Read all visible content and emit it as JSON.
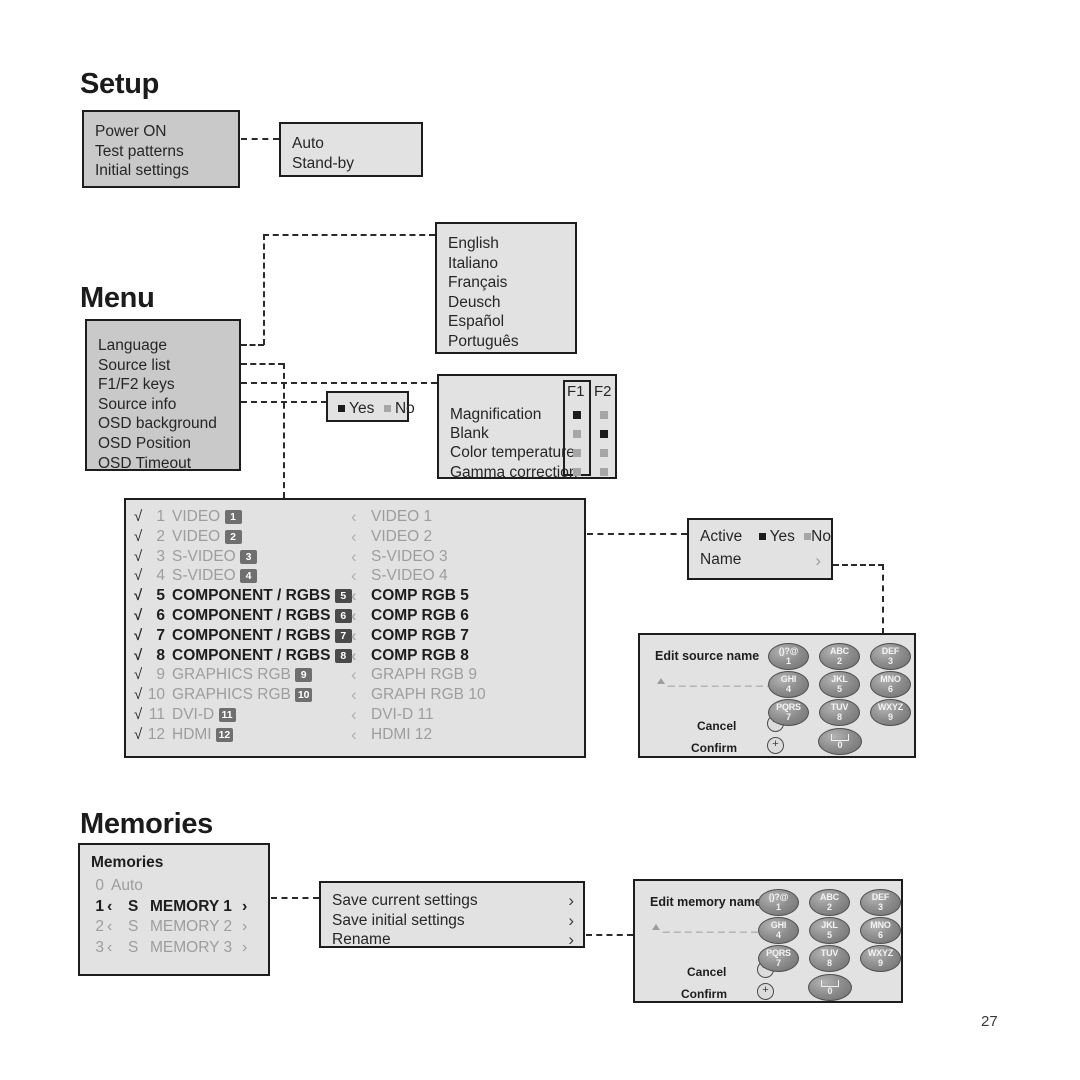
{
  "page": {
    "number": "27"
  },
  "sections": {
    "setup": {
      "title": "Setup"
    },
    "menu": {
      "title": "Menu"
    },
    "memories": {
      "title": "Memories"
    }
  },
  "setup": {
    "main_menu": {
      "items": [
        "Power ON",
        "Test patterns",
        "Initial settings"
      ]
    },
    "power_on_submenu": {
      "items": [
        "Auto",
        "Stand-by"
      ]
    }
  },
  "menu": {
    "main_menu": {
      "items": [
        "Language",
        "Source list",
        "F1/F2 keys",
        "Source info",
        "OSD background",
        "OSD Position",
        "OSD Timeout"
      ]
    },
    "language_submenu": {
      "items": [
        "English",
        "Italiano",
        "Français",
        "Deusch",
        "Español",
        "Português"
      ]
    },
    "source_info_submenu": {
      "options": [
        {
          "label": "Yes",
          "selected": true
        },
        {
          "label": "No",
          "selected": false
        }
      ]
    },
    "f1f2_submenu": {
      "columns": [
        "F1",
        "F2"
      ],
      "rows": [
        {
          "label": "Magnification",
          "f1": true,
          "f2": false
        },
        {
          "label": "Blank",
          "f1": false,
          "f2": true
        },
        {
          "label": "Color temperature",
          "f1": false,
          "f2": false
        },
        {
          "label": "Gamma correction",
          "f1": false,
          "f2": false
        }
      ]
    }
  },
  "source_list": {
    "rows": [
      {
        "check": "√",
        "index": "1",
        "name": "VIDEO",
        "badge": "1",
        "right": "VIDEO 1",
        "active": false
      },
      {
        "check": "√",
        "index": "2",
        "name": "VIDEO",
        "badge": "2",
        "right": "VIDEO 2",
        "active": false
      },
      {
        "check": "√",
        "index": "3",
        "name": "S-VIDEO",
        "badge": "3",
        "right": "S-VIDEO 3",
        "active": false
      },
      {
        "check": "√",
        "index": "4",
        "name": "S-VIDEO",
        "badge": "4",
        "right": "S-VIDEO 4",
        "active": false
      },
      {
        "check": "√",
        "index": "5",
        "name": "COMPONENT / RGBS",
        "badge": "5",
        "right": "COMP RGB 5",
        "active": true
      },
      {
        "check": "√",
        "index": "6",
        "name": "COMPONENT / RGBS",
        "badge": "6",
        "right": "COMP RGB 6",
        "active": true
      },
      {
        "check": "√",
        "index": "7",
        "name": "COMPONENT / RGBS",
        "badge": "7",
        "right": "COMP RGB 7",
        "active": true
      },
      {
        "check": "√",
        "index": "8",
        "name": "COMPONENT / RGBS",
        "badge": "8",
        "right": "COMP RGB 8",
        "active": true
      },
      {
        "check": "√",
        "index": "9",
        "name": "GRAPHICS RGB",
        "badge": "9",
        "right": "GRAPH RGB 9",
        "active": false
      },
      {
        "check": "√",
        "index": "10",
        "name": "GRAPHICS RGB",
        "badge": "10",
        "right": "GRAPH RGB 10",
        "active": false
      },
      {
        "check": "√",
        "index": "11",
        "name": "DVI-D",
        "badge": "11",
        "right": "DVI-D 11",
        "active": false
      },
      {
        "check": "√",
        "index": "12",
        "name": "HDMI",
        "badge": "12",
        "right": "HDMI 12",
        "active": false
      }
    ]
  },
  "source_properties": {
    "active_label": "Active",
    "options": [
      {
        "label": "Yes",
        "selected": true
      },
      {
        "label": "No",
        "selected": false
      }
    ],
    "name_label": "Name",
    "name_chevron": "›"
  },
  "edit_source_name": {
    "title": "Edit source name",
    "field_value": "_ _ _ _ _ _ _ _ _ _",
    "cancel_label": "Cancel",
    "cancel_symbol": "−",
    "confirm_label": "Confirm",
    "confirm_symbol": "+",
    "keys": [
      {
        "letters": "()?@",
        "digit": "1"
      },
      {
        "letters": "ABC",
        "digit": "2"
      },
      {
        "letters": "DEF",
        "digit": "3"
      },
      {
        "letters": "GHI",
        "digit": "4"
      },
      {
        "letters": "JKL",
        "digit": "5"
      },
      {
        "letters": "MNO",
        "digit": "6"
      },
      {
        "letters": "PQRS",
        "digit": "7"
      },
      {
        "letters": "TUV",
        "digit": "8"
      },
      {
        "letters": "WXYZ",
        "digit": "9"
      }
    ],
    "space_key": {
      "letters": "space",
      "digit": "0"
    }
  },
  "memories": {
    "title": "Memories",
    "rows": [
      {
        "index": "0",
        "left_chevron": "",
        "s": "",
        "name": "Auto",
        "right_chevron": "",
        "selected": false
      },
      {
        "index": "1",
        "left_chevron": "‹",
        "s": "S",
        "name": "MEMORY 1",
        "right_chevron": "›",
        "selected": true
      },
      {
        "index": "2",
        "left_chevron": "‹",
        "s": "S",
        "name": "MEMORY 2",
        "right_chevron": "›",
        "selected": false
      },
      {
        "index": "3",
        "left_chevron": "‹",
        "s": "S",
        "name": "MEMORY 3",
        "right_chevron": "›",
        "selected": false
      }
    ]
  },
  "memory_actions": {
    "rows": [
      {
        "label": "Save current settings",
        "chevron": "›"
      },
      {
        "label": "Save initial settings",
        "chevron": "›"
      },
      {
        "label": "Rename",
        "chevron": "›"
      }
    ]
  },
  "edit_memory_name": {
    "title": "Edit memory name",
    "field_value": "_ _ _ _ _ _ _ _ _ _",
    "cancel_label": "Cancel",
    "cancel_symbol": "−",
    "confirm_label": "Confirm",
    "confirm_symbol": "+",
    "keys": [
      {
        "letters": "()?@",
        "digit": "1"
      },
      {
        "letters": "ABC",
        "digit": "2"
      },
      {
        "letters": "DEF",
        "digit": "3"
      },
      {
        "letters": "GHI",
        "digit": "4"
      },
      {
        "letters": "JKL",
        "digit": "5"
      },
      {
        "letters": "MNO",
        "digit": "6"
      },
      {
        "letters": "PQRS",
        "digit": "7"
      },
      {
        "letters": "TUV",
        "digit": "8"
      },
      {
        "letters": "WXYZ",
        "digit": "9"
      }
    ],
    "space_key": {
      "letters": "space",
      "digit": "0"
    }
  },
  "colors": {
    "panel_fill": "#e2e2e2",
    "panel_fill_dark": "#c9c9c9",
    "panel_border": "#1d1d1d",
    "text": "#262626",
    "text_muted": "#9d9d9d",
    "badge_fill": "#6f6f6f",
    "marker_on": "#1c1c1c",
    "marker_off": "#a6a6a6"
  }
}
